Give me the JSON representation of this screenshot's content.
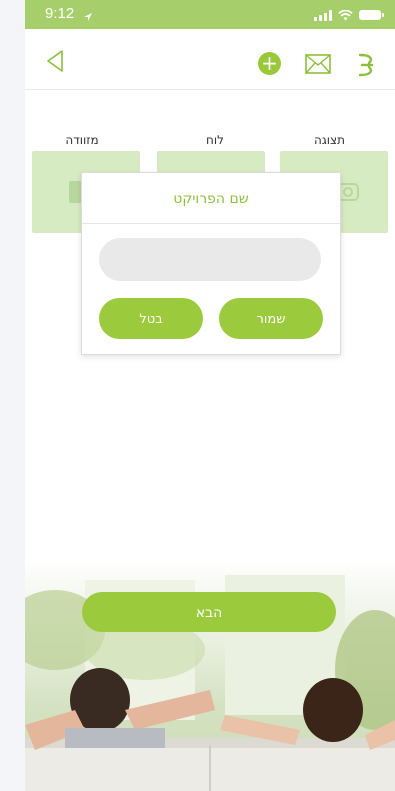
{
  "status_bar": {
    "time": "9:12",
    "colors": {
      "bg": "#a6cf6b"
    }
  },
  "header": {
    "icons": [
      "back-arrow-icon",
      "add-icon",
      "mail-icon",
      "menu-icon"
    ],
    "add_glyph": "+"
  },
  "categories": [
    {
      "label": "מזוודה"
    },
    {
      "label": "לוח"
    },
    {
      "label": "תצוגה"
    }
  ],
  "dialog": {
    "title": "שם הפרויקט",
    "input_value": "",
    "input_placeholder": "",
    "save_label": "שמור",
    "cancel_label": "בטל"
  },
  "footer": {
    "next_label": "הבא"
  },
  "colors": {
    "accent": "#9bca3c",
    "card": "#d7ebc2",
    "title": "#8cbf3a"
  }
}
